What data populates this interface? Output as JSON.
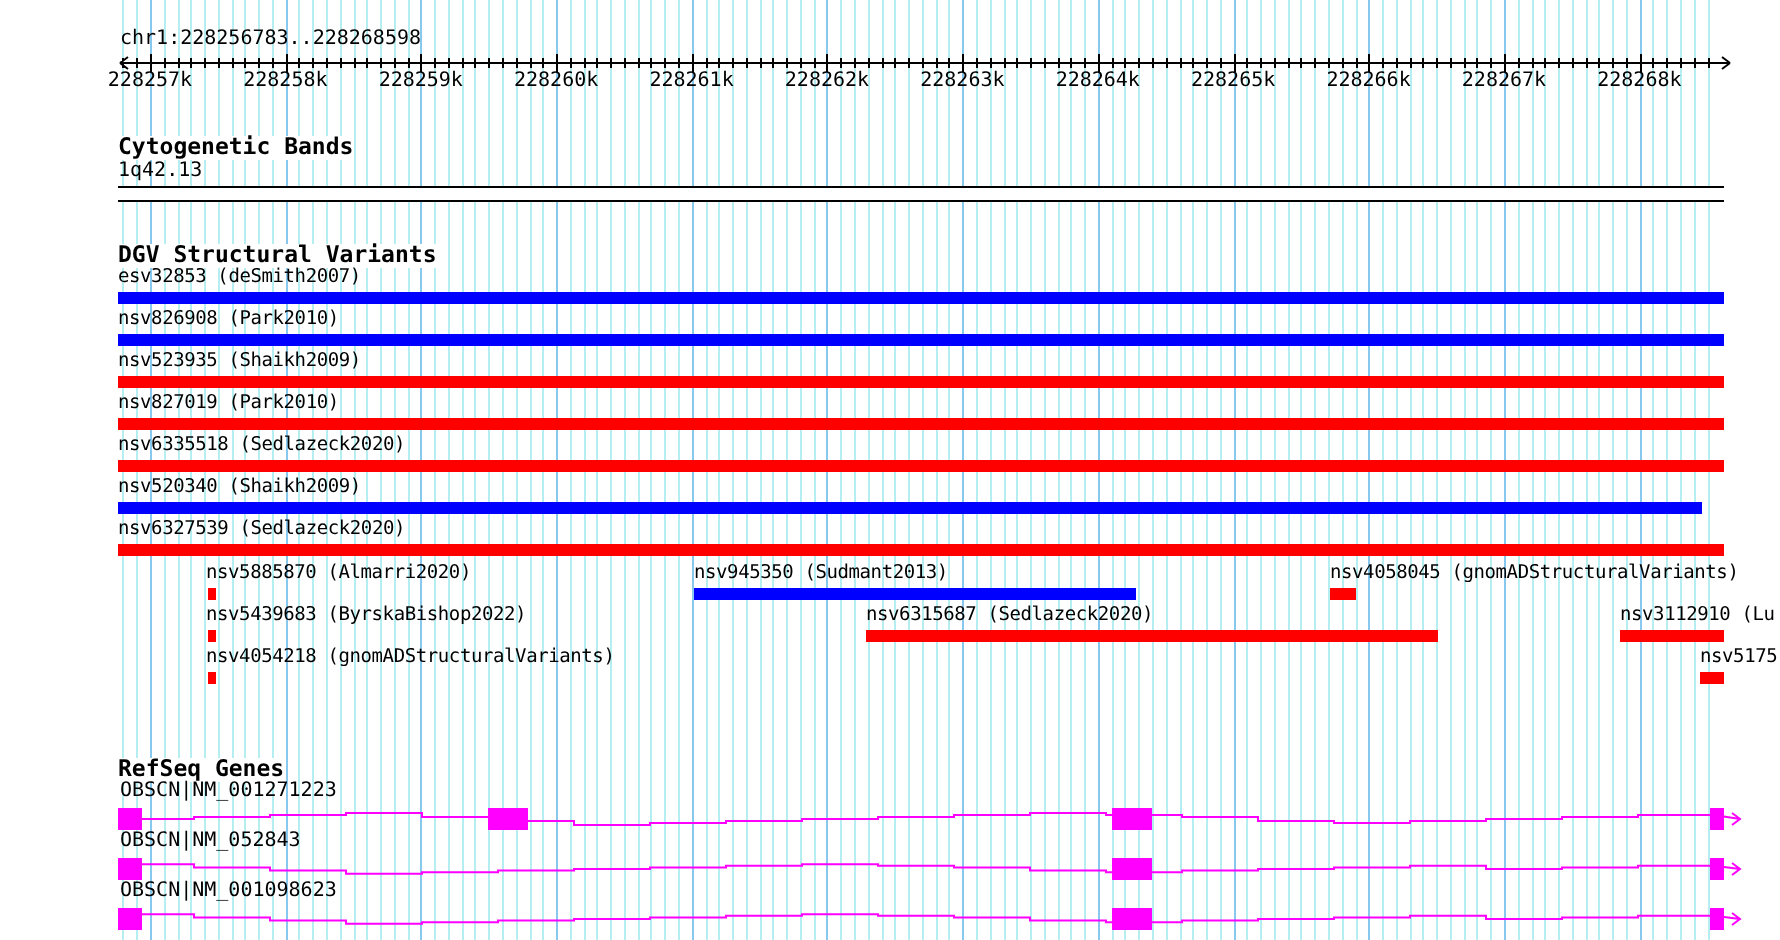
{
  "ruler": {
    "region": "chr1:228256783..228268598",
    "ticks": [
      "228257k",
      "228258k",
      "228259k",
      "228260k",
      "228261k",
      "228262k",
      "228263k",
      "228264k",
      "228265k",
      "228266k",
      "228267k",
      "228268k"
    ]
  },
  "tracks": [
    {
      "kind": "cytoband",
      "title": "Cytogenetic Bands",
      "band": "1q42.13"
    },
    {
      "kind": "variants",
      "title": "DGV Structural Variants",
      "features": [
        {
          "label": "esv32853 (deSmith2007)",
          "color": "#0000ff"
        },
        {
          "label": "nsv826908 (Park2010)",
          "color": "#0000ff"
        },
        {
          "label": "nsv523935 (Shaikh2009)",
          "color": "#ff0000"
        },
        {
          "label": "nsv827019 (Park2010)",
          "color": "#ff0000"
        },
        {
          "label": "nsv6335518 (Sedlazeck2020)",
          "color": "#ff0000"
        },
        {
          "label": "nsv520340 (Shaikh2009)",
          "color": "#0000ff"
        },
        {
          "label": "nsv6327539 (Sedlazeck2020)",
          "color": "#ff0000"
        },
        {
          "label": "nsv5885870 (Almarri2020)",
          "color": "#ff0000"
        },
        {
          "label": "nsv945350 (Sudmant2013)",
          "color": "#0000ff"
        },
        {
          "label": "nsv4058045 (gnomADStructuralVariants)",
          "color": "#ff0000"
        },
        {
          "label": "nsv5439683 (ByrskaBishop2022)",
          "color": "#ff0000"
        },
        {
          "label": "nsv6315687 (Sedlazeck2020)",
          "color": "#ff0000"
        },
        {
          "label": "nsv3112910 (Lu",
          "color": "#ff0000"
        },
        {
          "label": "nsv4054218 (gnomADStructuralVariants)",
          "color": "#ff0000"
        },
        {
          "label": "nsv5175",
          "color": "#ff0000"
        }
      ]
    },
    {
      "kind": "genes",
      "title": "RefSeq Genes",
      "transcripts": [
        {
          "label": "OBSCN|NM_001271223"
        },
        {
          "label": "OBSCN|NM_052843"
        },
        {
          "label": "OBSCN|NM_001098623"
        }
      ]
    }
  ]
}
